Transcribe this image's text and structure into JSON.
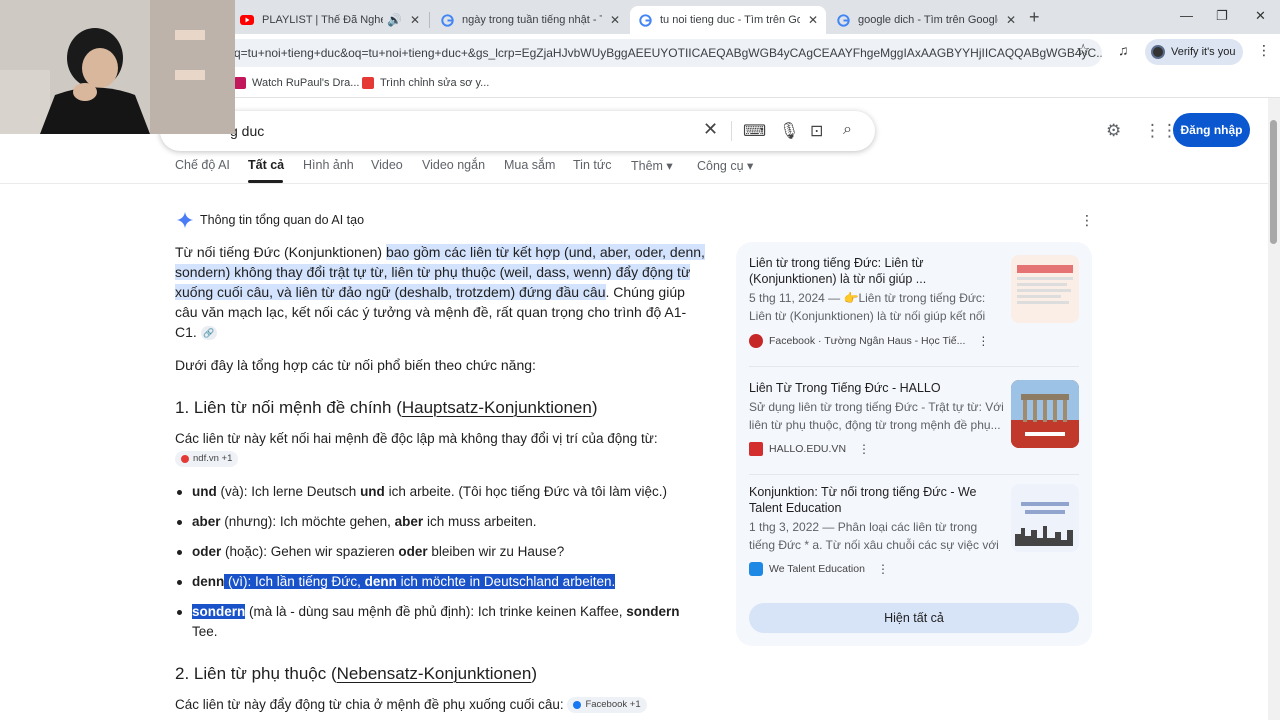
{
  "browser": {
    "tabs": [
      {
        "title": "PLAYLIST | Thế Đã Nghe Nhạc",
        "icon": "youtube-icon",
        "audio": true
      },
      {
        "title": "ngày trong tuần tiếng nhật - Tìm trên Google",
        "icon": "google-icon"
      },
      {
        "title": "tu noi tieng duc - Tìm trên Google",
        "icon": "google-icon",
        "active": true
      },
      {
        "title": "google dich - Tìm trên Google",
        "icon": "google-icon"
      }
    ],
    "url": "q=tu+noi+tieng+duc&oq=tu+noi+tieng+duc+&gs_lcrp=EgZjaHJvbWUyBggAEEUYOTIICAEQABgWGB4yCAgCEAAYFhgeMggIAxAAGBYYHjIICAQQABgWGB4yC...",
    "profile_label": "Verify it's you",
    "bookmarks": [
      {
        "label": "Watch RuPaul's Dra...",
        "color": "#c2185b"
      },
      {
        "label": "Trình chỉnh sửa sơ y...",
        "color": "#e53935"
      }
    ]
  },
  "search": {
    "query": "g duc",
    "signin_label": "Đăng nhập",
    "tabs": [
      "Chế độ AI",
      "Tất cả",
      "Hình ảnh",
      "Video",
      "Video ngắn",
      "Mua sắm",
      "Tin tức",
      "Thêm",
      "Công cụ"
    ],
    "active_tab": "Tất cả"
  },
  "ai_overview": {
    "heading": "Thông tin tổng quan do AI tạo",
    "intro_plain": "Từ nối tiếng Đức (Konjunktionen) ",
    "intro_highlight": "bao gồm các liên từ kết hợp (und, aber, oder, denn, sondern) không thay đổi trật tự từ, liên từ phụ thuộc (weil, dass, wenn) đẩy động từ xuống cuối câu, và liên từ đảo ngữ (deshalb, trotzdem) đứng đầu câu",
    "intro_rest": ". Chúng giúp câu văn mạch lạc, kết nối các ý tưởng và mệnh đề, rất quan trọng cho trình độ A1-C1.",
    "summary": "Dưới đây là tổng hợp các từ nối phổ biến theo chức năng:",
    "section1": {
      "prefix": "1. Liên từ nối mệnh đề chính (",
      "term": "Hauptsatz-Konjunktionen",
      "suffix": ")",
      "desc": "Các liên từ này kết nối hai mệnh đề độc lập mà không thay đổi vị trí của động từ:",
      "source_chip": "ndf.vn +1",
      "items": [
        {
          "word": "und",
          "meaning": " (và): Ich lerne Deutsch ",
          "kw": "und",
          "rest": " ich arbeite. (Tôi học tiếng Đức và tôi làm việc.)"
        },
        {
          "word": "aber",
          "meaning": " (nhưng): Ich möchte gehen, ",
          "kw": "aber",
          "rest": " ich muss arbeiten."
        },
        {
          "word": "oder",
          "meaning": " (hoặc): Gehen wir spazieren ",
          "kw": "oder",
          "rest": " bleiben wir zu Hause?"
        },
        {
          "word": "denn",
          "meaning": " (vì): Ich lần tiếng Đức, ",
          "kw": "denn",
          "rest": " ich möchte in Deutschland arbeiten."
        },
        {
          "word": "sondern",
          "meaning": " (mà là - dùng sau mệnh đề phủ định): Ich trinke keinen Kaffee, ",
          "kw": "sondern",
          "rest": " Tee."
        }
      ]
    },
    "section2": {
      "prefix": "2. Liên từ phụ thuộc (",
      "term": "Nebensatz-Konjunktionen",
      "suffix": ")",
      "desc": "Các liên từ này đẩy động từ chia ở mệnh đề phụ xuống cuối câu:",
      "source_chip": "Facebook +1"
    }
  },
  "sources": [
    {
      "title": "Liên từ trong tiếng Đức: Liên từ (Konjunktionen) là từ nối giúp ...",
      "snippet": "5 thg 11, 2024 — 👉Liên từ trong tiếng Đức: Liên từ (Konjunktionen) là từ nối giúp kết nối c...",
      "source": "Facebook · Tường Ngân Haus - Học Tiế...",
      "favicon_color": "#c62828"
    },
    {
      "title": "Liên Từ Trong Tiếng Đức - HALLO",
      "snippet": "Sử dụng liên từ trong tiếng Đức - Trật tự từ: Với liên từ phụ thuộc, động từ trong mệnh đề phụ...",
      "source": "HALLO.EDU.VN",
      "favicon_color": "#d32f2f"
    },
    {
      "title": "Konjunktion: Từ nối trong tiếng Đức - We Talent Education",
      "snippet": "1 thg 3, 2022 — Phân loại các liên từ trong tiếng Đức * a. Từ nối xâu chuỗi các sự việc với nhau:...",
      "source": "We Talent Education",
      "favicon_color": "#1e88e5"
    }
  ],
  "show_all_label": "Hiện tất cả",
  "colors": {
    "accent": "#0b57d0",
    "highlight": "#d3e3fd",
    "selection": "#1a53c9"
  }
}
